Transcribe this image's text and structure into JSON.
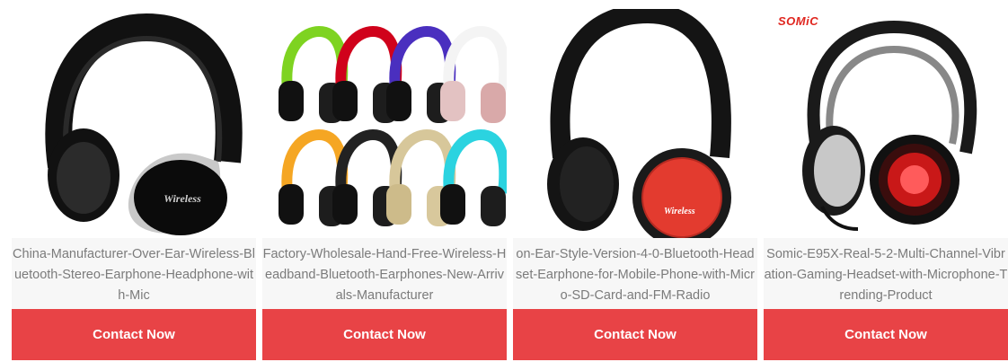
{
  "products": [
    {
      "name": "China-Manufacturer-Over-Ear-Wireless-Bluetooth-Stereo-Earphone-Headphone-with-Mic",
      "image_label": "Wireless",
      "cta": "Contact Now"
    },
    {
      "name": "Factory-Wholesale-Hand-Free-Wireless-Headband-Bluetooth-Earphones-New-Arrivals-Manufacturer",
      "cta": "Contact Now"
    },
    {
      "name": "on-Ear-Style-Version-4-0-Bluetooth-Headset-Earphone-for-Mobile-Phone-with-Micro-SD-Card-and-FM-Radio",
      "image_label": "Wireless",
      "cta": "Contact Now"
    },
    {
      "name": "Somic-E95X-Real-5-2-Multi-Channel-Vibration-Gaming-Headset-with-Microphone-Trending-Product",
      "brand": "SOMiC",
      "cta": "Contact Now"
    }
  ],
  "colors": {
    "cta_background": "#e84346",
    "cta_text": "#ffffff",
    "name_text": "#7b7b7b"
  }
}
